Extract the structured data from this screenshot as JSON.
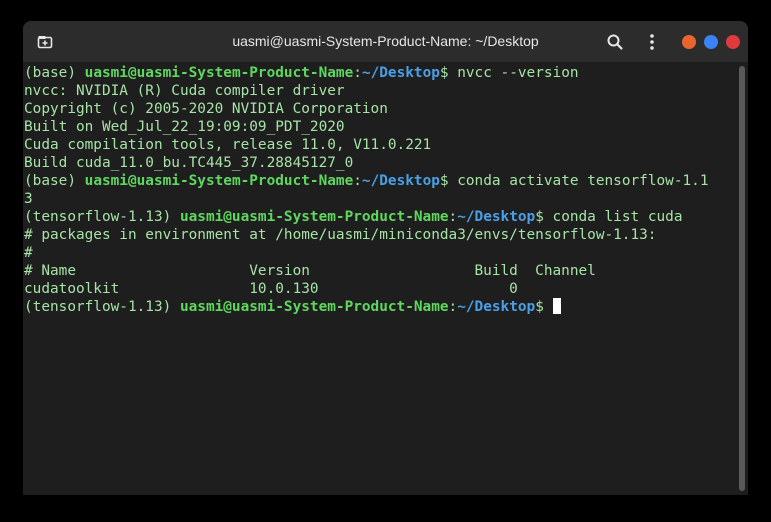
{
  "window": {
    "title": "uasmi@uasmi-System-Product-Name: ~/Desktop",
    "buttons": {
      "minimize_color": "#e9652f",
      "maximize_color": "#3b82f6",
      "close_color": "#e0393e"
    }
  },
  "terminal": {
    "lines": [
      {
        "env": "(base) ",
        "user": "uasmi@uasmi-System-Product-Name",
        "sep": ":",
        "path": "~/Desktop",
        "cmd": "$ nvcc --version"
      },
      {
        "text": "nvcc: NVIDIA (R) Cuda compiler driver"
      },
      {
        "text": "Copyright (c) 2005-2020 NVIDIA Corporation"
      },
      {
        "text": "Built on Wed_Jul_22_19:09:09_PDT_2020"
      },
      {
        "text": "Cuda compilation tools, release 11.0, V11.0.221"
      },
      {
        "text": "Build cuda_11.0_bu.TC445_37.28845127_0"
      },
      {
        "env": "(base) ",
        "user": "uasmi@uasmi-System-Product-Name",
        "sep": ":",
        "path": "~/Desktop",
        "cmd": "$ conda activate tensorflow-1.1"
      },
      {
        "text": "3"
      },
      {
        "env": "(tensorflow-1.13) ",
        "user": "uasmi@uasmi-System-Product-Name",
        "sep": ":",
        "path": "~/Desktop",
        "cmd": "$ conda list cuda"
      },
      {
        "text": "# packages in environment at /home/uasmi/miniconda3/envs/tensorflow-1.13:"
      },
      {
        "text": "#"
      },
      {
        "text": "# Name                    Version                   Build  Channel"
      },
      {
        "text": "cudatoolkit               10.0.130                      0"
      },
      {
        "env": "(tensorflow-1.13) ",
        "user": "uasmi@uasmi-System-Product-Name",
        "sep": ":",
        "path": "~/Desktop",
        "cmd": "$ ",
        "cursor": true
      }
    ]
  }
}
